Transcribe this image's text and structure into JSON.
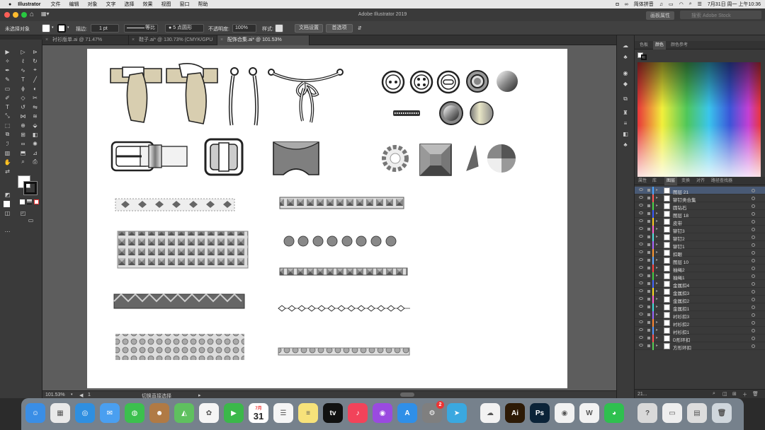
{
  "menubar": {
    "apple": "",
    "items": [
      "Illustrator",
      "文件",
      "编辑",
      "对象",
      "文字",
      "选择",
      "效果",
      "视图",
      "窗口",
      "帮助"
    ],
    "ime": "简体拼音",
    "clock": "7月31日 周一 上午10:36"
  },
  "titlebar": {
    "title": "Adobe Illustrator 2019",
    "workspace": "画板属性",
    "search_placeholder": "搜索 Adobe Stock"
  },
  "control": {
    "no_selection": "未选择对象",
    "stroke_label": "描边:",
    "stroke_value": "1 pt",
    "line_style": "等比",
    "brush": "5 点圆形",
    "opacity_label": "不透明度:",
    "opacity_value": "100%",
    "style_label": "样式:",
    "doc_setup": "文档设置",
    "prefs": "首选项"
  },
  "tabs": [
    {
      "label": "衬衫版单.ai @ 71.47% (CMYK/GPU 预览)"
    },
    {
      "label": "鞋子.ai* @ 130.73% (CMYK/GPU 预览)"
    },
    {
      "label": "配饰合集.ai* @ 101.53% (CMYK/GPU 预览)",
      "active": true
    }
  ],
  "status": {
    "zoom": "101.53%",
    "artboard": "1",
    "tool": "切换直接选择"
  },
  "color_panel": {
    "tabs": [
      "色板",
      "颜色",
      "颜色参考"
    ],
    "active": "颜色"
  },
  "layers_panel": {
    "tabs": [
      "属性",
      "库",
      "图层",
      "变换",
      "对齐",
      "路径查找器"
    ],
    "active": "图层",
    "count": "21...",
    "layers": [
      {
        "name": "图层 21",
        "color": "#4aa3ff"
      },
      {
        "name": "铆钉类合集",
        "color": "#ff5a5a"
      },
      {
        "name": "圆钻石",
        "color": "#4ad44a"
      },
      {
        "name": "图层 18",
        "color": "#3a5aff"
      },
      {
        "name": "皮带",
        "color": "#ffcc22"
      },
      {
        "name": "铆钉3",
        "color": "#ff66cc"
      },
      {
        "name": "铆钉2",
        "color": "#55e0e0"
      },
      {
        "name": "铆钉1",
        "color": "#aa66ff"
      },
      {
        "name": "扣眼",
        "color": "#ff9933"
      },
      {
        "name": "图层 10",
        "color": "#66aaff"
      },
      {
        "name": "抽绳2",
        "color": "#ff4444"
      },
      {
        "name": "抽绳1",
        "color": "#44cc44"
      },
      {
        "name": "金属扣4",
        "color": "#4466ff"
      },
      {
        "name": "金属扣3",
        "color": "#ffdd22"
      },
      {
        "name": "金属扣2",
        "color": "#ff66cc"
      },
      {
        "name": "金属扣1",
        "color": "#44dddd"
      },
      {
        "name": "衬衫扣3",
        "color": "#9966ff"
      },
      {
        "name": "衬衫扣2",
        "color": "#ff8833"
      },
      {
        "name": "衬衫扣1",
        "color": "#5599ff"
      },
      {
        "name": "D形环扣",
        "color": "#ff5555"
      },
      {
        "name": "方形环扣",
        "color": "#55cc55"
      }
    ]
  },
  "dock": {
    "calendar_month": "7月",
    "calendar_day": "31",
    "badge": "2",
    "apps": [
      {
        "name": "finder",
        "color": "#3a8ee6",
        "glyph": "☺"
      },
      {
        "name": "launchpad",
        "color": "#e9e9e9",
        "glyph": "▦"
      },
      {
        "name": "safari",
        "color": "#2f8fe0",
        "glyph": "◎"
      },
      {
        "name": "mail",
        "color": "#4a9ff0",
        "glyph": "✉"
      },
      {
        "name": "messages",
        "color": "#3cc04e",
        "glyph": "◍"
      },
      {
        "name": "contacts",
        "color": "#b07a45",
        "glyph": "☻"
      },
      {
        "name": "maps",
        "color": "#5fc05f",
        "glyph": "◭"
      },
      {
        "name": "photos",
        "color": "#f5f5f5",
        "glyph": "✿"
      },
      {
        "name": "facetime",
        "color": "#3bb84a",
        "glyph": "▶"
      },
      {
        "name": "calendar",
        "color": "#ffffff",
        "glyph": ""
      },
      {
        "name": "reminders",
        "color": "#f5f5f5",
        "glyph": "☰"
      },
      {
        "name": "notes",
        "color": "#f7e27a",
        "glyph": "≡"
      },
      {
        "name": "tv",
        "color": "#111111",
        "glyph": "tv"
      },
      {
        "name": "music",
        "color": "#f2435a",
        "glyph": "♪"
      },
      {
        "name": "podcasts",
        "color": "#9a4ae0",
        "glyph": "◉"
      },
      {
        "name": "appstore",
        "color": "#2f8fe8",
        "glyph": "A"
      },
      {
        "name": "system-preferences",
        "color": "#7f7f7f",
        "glyph": "⚙"
      },
      {
        "name": "telegram",
        "color": "#3aa8e0",
        "glyph": "➤"
      },
      {
        "name": "baidu-netdisk",
        "color": "#f2f2f2",
        "glyph": "☁"
      },
      {
        "name": "illustrator",
        "color": "#2d1a06",
        "glyph": "Ai"
      },
      {
        "name": "photoshop",
        "color": "#0b2338",
        "glyph": "Ps"
      },
      {
        "name": "chrome",
        "color": "#f2f2f2",
        "glyph": "◉"
      },
      {
        "name": "wps",
        "color": "#f2f2f2",
        "glyph": "W"
      },
      {
        "name": "wechat",
        "color": "#2fc04f",
        "glyph": "◕"
      },
      {
        "name": "help",
        "color": "#d9d9d9",
        "glyph": "?"
      },
      {
        "name": "preview",
        "color": "#eeeeee",
        "glyph": "▭"
      },
      {
        "name": "downloads",
        "color": "#dddddd",
        "glyph": "▤"
      },
      {
        "name": "trash",
        "color": "#cfd6dc",
        "glyph": "🗑"
      }
    ]
  }
}
